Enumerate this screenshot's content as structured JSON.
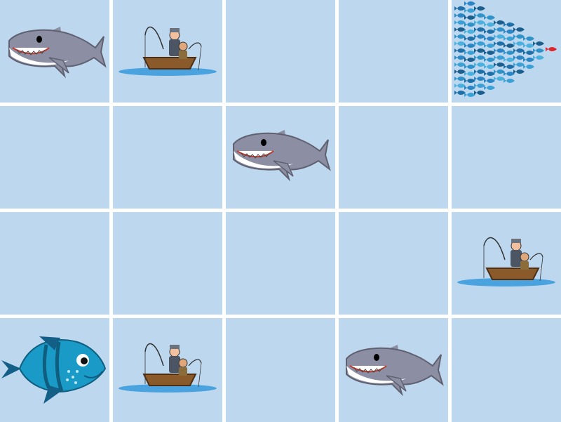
{
  "grid": {
    "rows": 4,
    "cols": 5,
    "cell_color": "#bdd7ee",
    "gap_color": "#ffffff"
  },
  "cells": [
    [
      "shark-icon",
      "fishermen-boat-icon",
      "empty",
      "empty",
      "fish-school-icon"
    ],
    [
      "empty",
      "empty",
      "shark-icon",
      "empty",
      "empty"
    ],
    [
      "empty",
      "empty",
      "empty",
      "empty",
      "fishermen-boat-icon"
    ],
    [
      "blue-fish-icon",
      "fishermen-boat-icon",
      "empty",
      "shark-icon",
      "empty"
    ]
  ],
  "colors": {
    "shark": "#8c8ea3",
    "fish": "#1a9bc7",
    "boat": "#8b5a2b",
    "water": "#4aa3df",
    "leader_fish": "#e0242b"
  }
}
